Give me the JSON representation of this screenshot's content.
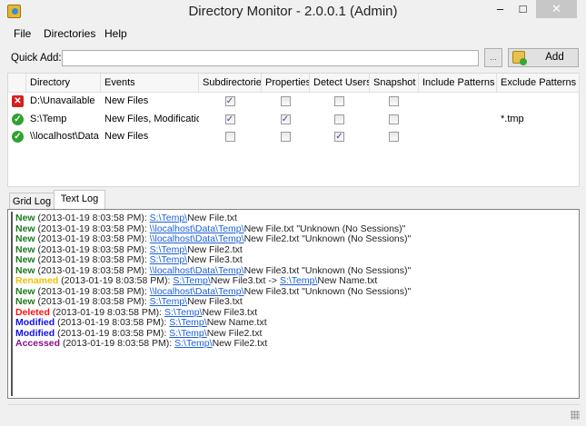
{
  "window": {
    "title": "Directory Monitor - 2.0.0.1 (Admin)",
    "minimize": "–",
    "maximize": "□",
    "close": "✕"
  },
  "menu": [
    "File",
    "Directories",
    "Help"
  ],
  "quick_add": {
    "label": "Quick Add:",
    "value": "",
    "browse": "...",
    "add": "Add"
  },
  "grid": {
    "columns": [
      "Directory",
      "Events",
      "Subdirectories",
      "Properties",
      "Detect Users",
      "Snapshot",
      "Include Patterns",
      "Exclude Patterns"
    ],
    "rows": [
      {
        "status": "error",
        "directory": "D:\\Unavailable",
        "events": "New Files",
        "subdirectories": true,
        "properties": false,
        "detect_users": false,
        "snapshot": false,
        "include": "",
        "exclude": ""
      },
      {
        "status": "ok",
        "directory": "S:\\Temp",
        "events": "New Files, Modificatio...",
        "subdirectories": true,
        "properties": true,
        "detect_users": false,
        "snapshot": false,
        "include": "",
        "exclude": "*.tmp"
      },
      {
        "status": "ok",
        "directory": "\\\\localhost\\Data",
        "events": "New Files",
        "subdirectories": false,
        "properties": false,
        "detect_users": true,
        "snapshot": false,
        "include": "",
        "exclude": ""
      }
    ]
  },
  "tabs": [
    {
      "label": "Grid Log",
      "active": false
    },
    {
      "label": "Text Log",
      "active": true
    }
  ],
  "colors": {
    "New": "#1a7a1a",
    "Renamed": "#f0c000",
    "Deleted": "#ff1010",
    "Modified": "#1010e0",
    "Accessed": "#8a108a"
  },
  "log": [
    {
      "type": "New",
      "time": " (2013-01-19 8:03:58 PM): ",
      "parts": [
        {
          "link": "S:\\Temp\\"
        },
        {
          "text": "New File.txt"
        }
      ]
    },
    {
      "type": "New",
      "time": " (2013-01-19 8:03:58 PM): ",
      "parts": [
        {
          "link": "\\\\localhost\\Data\\Temp\\"
        },
        {
          "text": "New File.txt \"Unknown (No Sessions)\""
        }
      ]
    },
    {
      "type": "New",
      "time": " (2013-01-19 8:03:58 PM): ",
      "parts": [
        {
          "link": "\\\\localhost\\Data\\Temp\\"
        },
        {
          "text": "New File2.txt \"Unknown (No Sessions)\""
        }
      ]
    },
    {
      "type": "New",
      "time": " (2013-01-19 8:03:58 PM): ",
      "parts": [
        {
          "link": "S:\\Temp\\"
        },
        {
          "text": "New File2.txt"
        }
      ]
    },
    {
      "type": "New",
      "time": " (2013-01-19 8:03:58 PM): ",
      "parts": [
        {
          "link": "S:\\Temp\\"
        },
        {
          "text": "New File3.txt"
        }
      ]
    },
    {
      "type": "New",
      "time": " (2013-01-19 8:03:58 PM): ",
      "parts": [
        {
          "link": "\\\\localhost\\Data\\Temp\\"
        },
        {
          "text": "New File3.txt \"Unknown (No Sessions)\""
        }
      ]
    },
    {
      "type": "Renamed",
      "time": " (2013-01-19 8:03:58 PM): ",
      "parts": [
        {
          "link": "S:\\Temp\\"
        },
        {
          "text": "New File3.txt -> "
        },
        {
          "link": "S:\\Temp\\"
        },
        {
          "text": "New Name.txt"
        }
      ]
    },
    {
      "type": "New",
      "time": " (2013-01-19 8:03:58 PM): ",
      "parts": [
        {
          "link": "\\\\localhost\\Data\\Temp\\"
        },
        {
          "text": "New File3.txt \"Unknown (No Sessions)\""
        }
      ]
    },
    {
      "type": "New",
      "time": " (2013-01-19 8:03:58 PM): ",
      "parts": [
        {
          "link": "S:\\Temp\\"
        },
        {
          "text": "New File3.txt"
        }
      ]
    },
    {
      "type": "Deleted",
      "time": " (2013-01-19 8:03:58 PM): ",
      "parts": [
        {
          "link": "S:\\Temp\\"
        },
        {
          "text": "New File3.txt"
        }
      ]
    },
    {
      "type": "Modified",
      "time": " (2013-01-19 8:03:58 PM): ",
      "parts": [
        {
          "link": "S:\\Temp\\"
        },
        {
          "text": "New Name.txt"
        }
      ]
    },
    {
      "type": "Modified",
      "time": " (2013-01-19 8:03:58 PM): ",
      "parts": [
        {
          "link": "S:\\Temp\\"
        },
        {
          "text": "New File2.txt"
        }
      ]
    },
    {
      "type": "Accessed",
      "time": " (2013-01-19 8:03:58 PM): ",
      "parts": [
        {
          "link": "S:\\Temp\\"
        },
        {
          "text": "New File2.txt"
        }
      ]
    }
  ]
}
